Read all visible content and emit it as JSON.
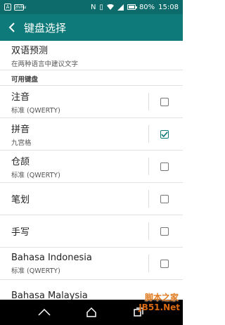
{
  "status_bar": {
    "notif1": "A",
    "notif2": "zhihu",
    "battery_percent": "80%",
    "time": "15:08",
    "battery_level": 0.8
  },
  "app_bar": {
    "title": "键盘选择"
  },
  "bilingual": {
    "title": "双语预测",
    "subtitle": "在两种语言中建议文字"
  },
  "section": {
    "label": "可用键盘"
  },
  "keyboards": [
    {
      "title": "注音",
      "subtitle": "标准 (QWERTY)",
      "checked": false
    },
    {
      "title": "拼音",
      "subtitle": "九宫格",
      "checked": true
    },
    {
      "title": "仓颉",
      "subtitle": "标准 (QWERTY)",
      "checked": false
    },
    {
      "title": "笔划",
      "subtitle": "",
      "checked": false
    },
    {
      "title": "手写",
      "subtitle": "",
      "checked": false
    },
    {
      "title": "Bahasa Indonesia",
      "subtitle": "标准 (QWERTY)",
      "checked": false
    },
    {
      "title": "Bahasa Malaysia",
      "subtitle": "",
      "checked": false
    }
  ],
  "watermark": {
    "line1": "脚本之家",
    "line2": "JB51.Net"
  },
  "colors": {
    "status_bar": "#0d6b6b",
    "app_bar": "#0f7a7a",
    "accent": "#0f7a7a"
  }
}
